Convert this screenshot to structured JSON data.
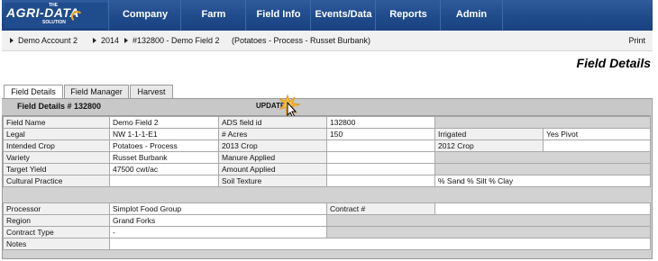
{
  "logo": {
    "the": "THE",
    "main": "AGRI-DATA",
    "sub": "SOLUTION"
  },
  "nav": {
    "items": [
      "Company",
      "Farm",
      "Field Info",
      "Events/Data",
      "Reports",
      "Admin"
    ]
  },
  "breadcrumb": {
    "account": "Demo Account 2",
    "year": "2014",
    "field": "#132800 - Demo Field 2",
    "crop": "(Potatoes - Process - Russet Burbank)",
    "print": "Print"
  },
  "page_title": "Field Details",
  "tabs": [
    "Field Details",
    "Field Manager",
    "Harvest"
  ],
  "panel": {
    "title": "Field Details # 132800",
    "update": "UPDATE"
  },
  "fields": {
    "field_name_label": "Field Name",
    "field_name": "Demo Field 2",
    "ads_label": "ADS field id",
    "ads": "132800",
    "legal_label": "Legal",
    "legal": "NW 1-1-1-E1",
    "acres_label": "# Acres",
    "acres": "150",
    "irrigated_label": "Irrigated",
    "irrigated": "Yes  Pivot",
    "intended_crop_label": "Intended Crop",
    "intended_crop": "Potatoes - Process",
    "crop2013_label": "2013 Crop",
    "crop2013": "",
    "crop2012_label": "2012 Crop",
    "crop2012": "",
    "variety_label": "Variety",
    "variety": "Russet Burbank",
    "manure_label": "Manure Applied",
    "manure": "",
    "target_yield_label": "Target Yield",
    "target_yield": "47500 cwt/ac",
    "amount_label": "Amount Applied",
    "amount": "",
    "cultural_label": "Cultural Practice",
    "cultural": "",
    "soil_label": "Soil Texture",
    "soil": "% Sand  % Silt  % Clay",
    "processor_label": "Processor",
    "processor": "Simplot Food Group",
    "contract_no_label": "Contract #",
    "contract_no": "",
    "region_label": "Region",
    "region": "Grand Forks",
    "contract_type_label": "Contract Type",
    "contract_type": "-",
    "notes_label": "Notes",
    "notes": ""
  },
  "colors": {
    "nav_bg": "#1e4a8a",
    "logo_accent": "#e8a41a",
    "panel_bg": "#c8c8c8"
  }
}
